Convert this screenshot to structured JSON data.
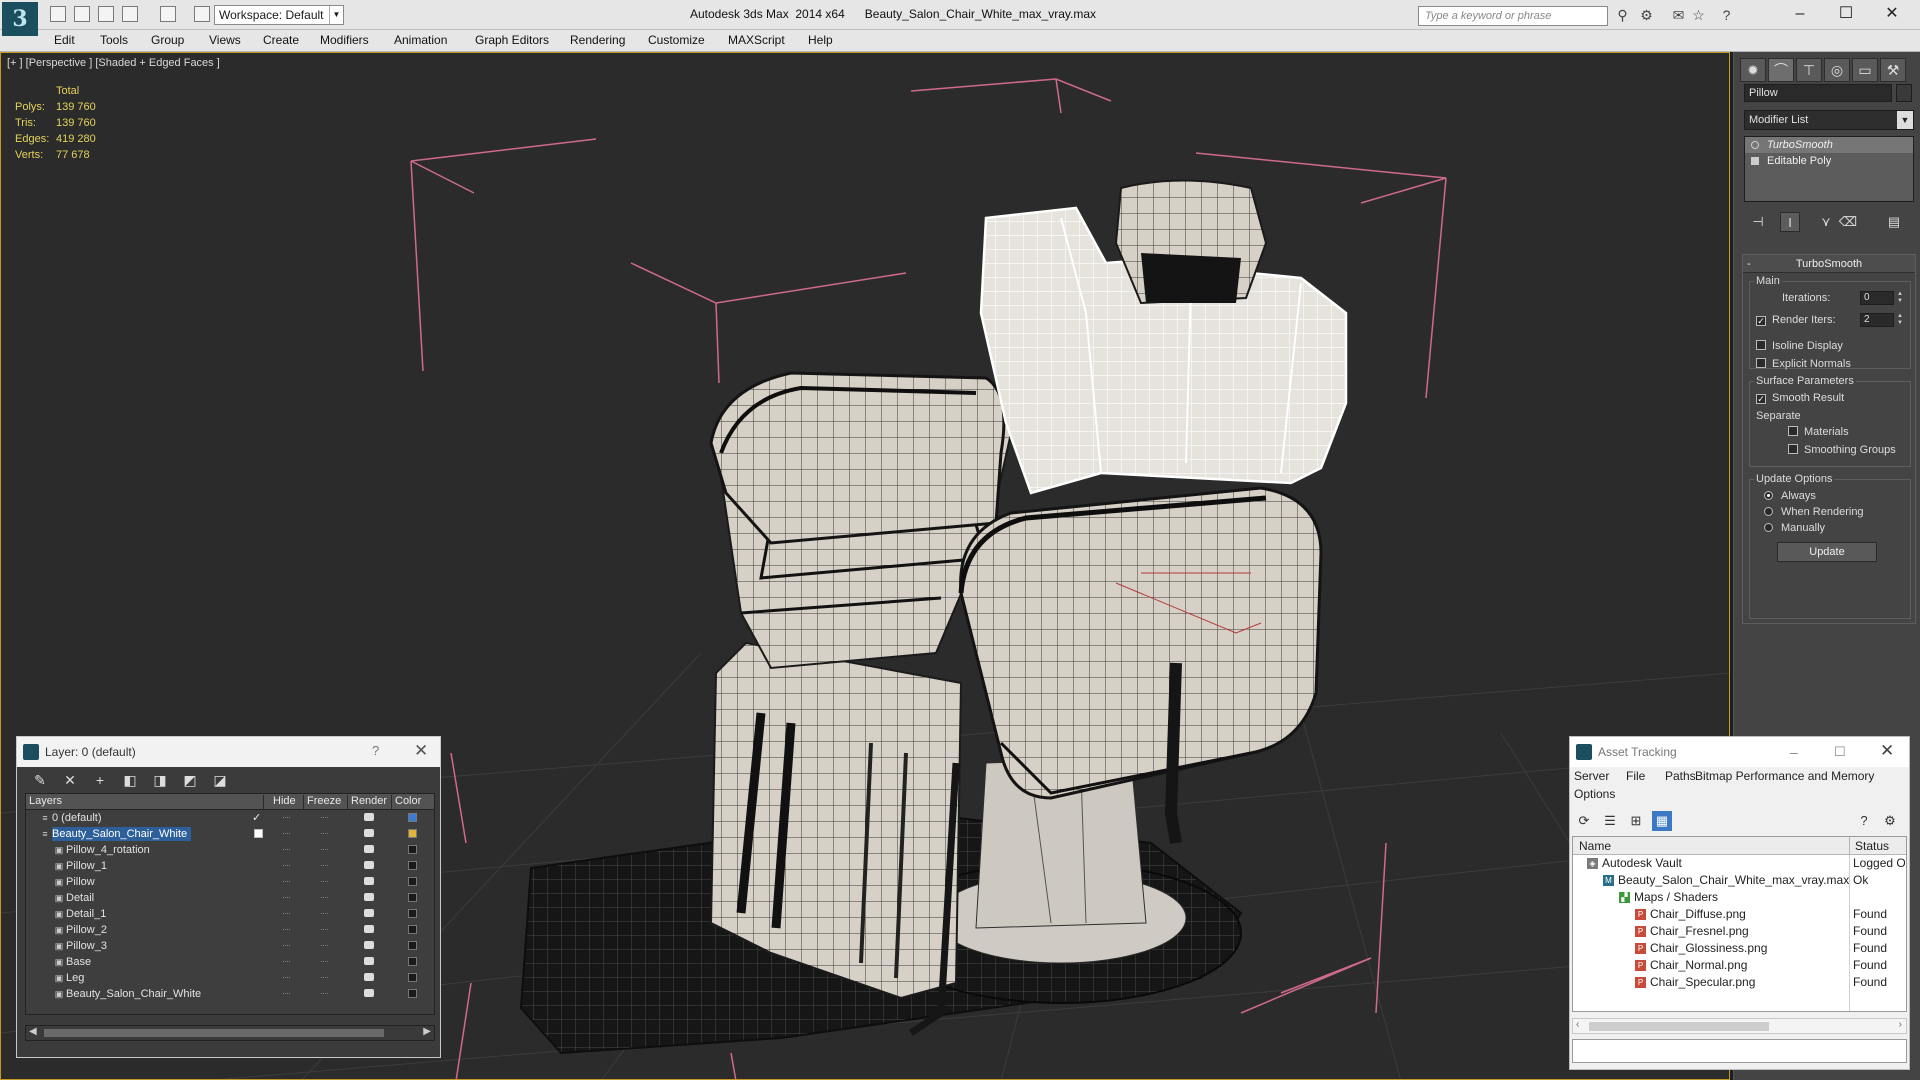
{
  "titlebar": {
    "app": "Autodesk 3ds Max  2014 x64",
    "file": "Beauty_Salon_Chair_White_max_vray.max",
    "workspace": "Workspace: Default",
    "search_placeholder": "Type a keyword or phrase",
    "minimize": "–",
    "maximize": "☐",
    "close": "✕"
  },
  "menu": [
    "Edit",
    "Tools",
    "Group",
    "Views",
    "Create",
    "Modifiers",
    "Animation",
    "Graph Editors",
    "Rendering",
    "Customize",
    "MAXScript",
    "Help"
  ],
  "viewport": {
    "label": "[+ ] [Perspective ] [Shaded + Edged Faces ]",
    "stats_header": "Total",
    "stats": [
      {
        "k": "Polys:",
        "v": "139 760"
      },
      {
        "k": "Tris:",
        "v": "139 760"
      },
      {
        "k": "Edges:",
        "v": "419 280"
      },
      {
        "k": "Verts:",
        "v": "77 678"
      }
    ]
  },
  "command_panel": {
    "object_name": "Pillow",
    "modifier_list": "Modifier List",
    "stack": [
      "TurboSmooth",
      "Editable Poly"
    ],
    "rollout_title": "TurboSmooth",
    "main_group": "Main",
    "iterations_label": "Iterations:",
    "iterations_value": "0",
    "render_iters_label": "Render Iters:",
    "render_iters_value": "2",
    "isoline_label": "Isoline Display",
    "explicit_normals_label": "Explicit Normals",
    "surface_group": "Surface Parameters",
    "smooth_result_label": "Smooth Result",
    "separate_label": "Separate",
    "materials_label": "Materials",
    "smoothing_groups_label": "Smoothing Groups",
    "update_group": "Update Options",
    "always_label": "Always",
    "when_rendering_label": "When Rendering",
    "manually_label": "Manually",
    "update_button": "Update"
  },
  "layer_dialog": {
    "title": "Layer: 0 (default)",
    "help": "?",
    "close": "✕",
    "columns": [
      "Layers",
      "Hide",
      "Freeze",
      "Render",
      "Color"
    ],
    "rows": [
      {
        "name": "0 (default)",
        "level": 0,
        "active": true,
        "color": "#3a7bd5"
      },
      {
        "name": "Beauty_Salon_Chair_White",
        "level": 0,
        "selected": true,
        "color": "#e0b43c"
      },
      {
        "name": "Pillow_4_rotation",
        "level": 1,
        "color": "#1a1a1a"
      },
      {
        "name": "Pillow_1",
        "level": 1,
        "color": "#1a1a1a"
      },
      {
        "name": "Pillow",
        "level": 1,
        "color": "#1a1a1a"
      },
      {
        "name": "Detail",
        "level": 1,
        "color": "#1a1a1a"
      },
      {
        "name": "Detail_1",
        "level": 1,
        "color": "#1a1a1a"
      },
      {
        "name": "Pillow_2",
        "level": 1,
        "color": "#1a1a1a"
      },
      {
        "name": "Pillow_3",
        "level": 1,
        "color": "#1a1a1a"
      },
      {
        "name": "Base",
        "level": 1,
        "color": "#1a1a1a"
      },
      {
        "name": "Leg",
        "level": 1,
        "color": "#1a1a1a"
      },
      {
        "name": "Beauty_Salon_Chair_White",
        "level": 1,
        "color": "#1a1a1a"
      }
    ]
  },
  "asset_dialog": {
    "title": "Asset Tracking",
    "menu": [
      "Server",
      "File",
      "Paths",
      "Bitmap Performance and Memory",
      "Options"
    ],
    "columns": [
      "Name",
      "Status"
    ],
    "rows": [
      {
        "name": "Autodesk Vault",
        "status": "Logged O",
        "level": 0,
        "icon": "vault"
      },
      {
        "name": "Beauty_Salon_Chair_White_max_vray.max",
        "status": "Ok",
        "level": 1,
        "icon": "max"
      },
      {
        "name": "Maps / Shaders",
        "status": "",
        "level": 2,
        "icon": "maps"
      },
      {
        "name": "Chair_Diffuse.png",
        "status": "Found",
        "level": 3,
        "icon": "png"
      },
      {
        "name": "Chair_Fresnel.png",
        "status": "Found",
        "level": 3,
        "icon": "png"
      },
      {
        "name": "Chair_Glossiness.png",
        "status": "Found",
        "level": 3,
        "icon": "png"
      },
      {
        "name": "Chair_Normal.png",
        "status": "Found",
        "level": 3,
        "icon": "png"
      },
      {
        "name": "Chair_Specular.png",
        "status": "Found",
        "level": 3,
        "icon": "png"
      }
    ]
  },
  "colors": {
    "viewport_bg": "#2b2b2b",
    "stats_text": "#e4d25a",
    "selection": "#2d5f9a",
    "bounding_box": "#d06a8a",
    "active_border": "#c59a22"
  }
}
